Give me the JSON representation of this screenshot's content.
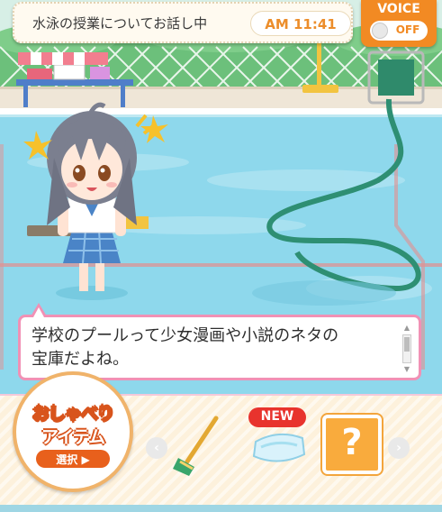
{
  "status": {
    "title": "水泳の授業についてお話し中",
    "time": "AM 11:41"
  },
  "voice": {
    "label": "VOICE",
    "state": "OFF"
  },
  "dialog": {
    "line1": "学校のプールって少女漫画や小説のネタの",
    "line2": "宝庫だよね。"
  },
  "item_menu": {
    "line1": "おしゃべり",
    "line2": "アイテム",
    "select_label": "選択 ▶"
  },
  "items": {
    "new_badge": "NEW",
    "mystery_label": "?"
  },
  "icons": {
    "left_arrow": "chevron-left-icon",
    "right_arrow": "chevron-right-icon",
    "broom": "broom-icon",
    "kickboard": "kickboard-icon"
  },
  "colors": {
    "accent_orange": "#f28a23",
    "dialog_border": "#f191b5",
    "time_text": "#ec8d2a",
    "new_badge": "#e8332d"
  }
}
